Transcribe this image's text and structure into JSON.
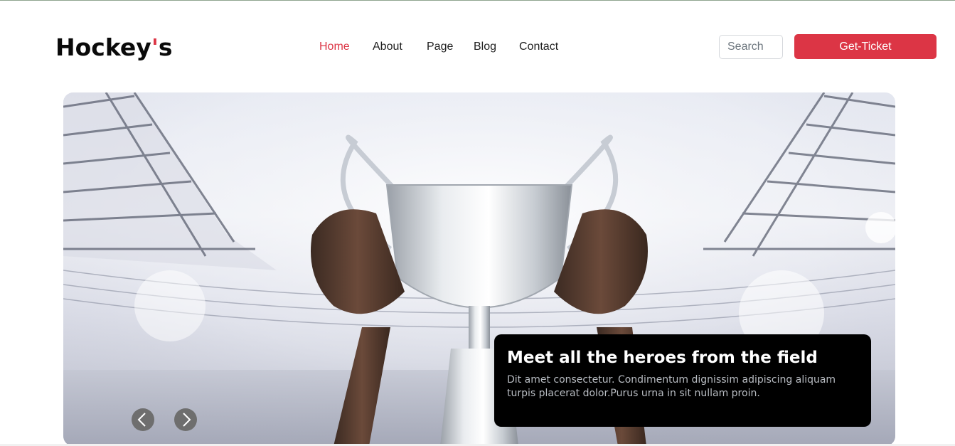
{
  "brand": {
    "name": "Hockey",
    "apostrophe": "'",
    "suffix": "s"
  },
  "nav": {
    "items": [
      {
        "label": "Home",
        "active": true
      },
      {
        "label": "About",
        "active": false
      },
      {
        "label": "Page",
        "active": false
      },
      {
        "label": "Blog",
        "active": false
      },
      {
        "label": "Contact",
        "active": false
      }
    ]
  },
  "search": {
    "placeholder": "Search",
    "value": ""
  },
  "cta": {
    "label": "Get-Ticket"
  },
  "hero": {
    "image": "trophy-raised-in-stadium",
    "caption_title": "Meet all the heroes from the field",
    "caption_text": "Dit amet consectetur. Condimentum dignissim adipiscing aliquam turpis placerat dolor.Purus urna in sit nullam proin.",
    "prev_icon": "chevron-left-icon",
    "next_icon": "chevron-right-icon"
  },
  "colors": {
    "accent": "#dc3545",
    "caption_bg": "#000000",
    "text": "#212121"
  }
}
